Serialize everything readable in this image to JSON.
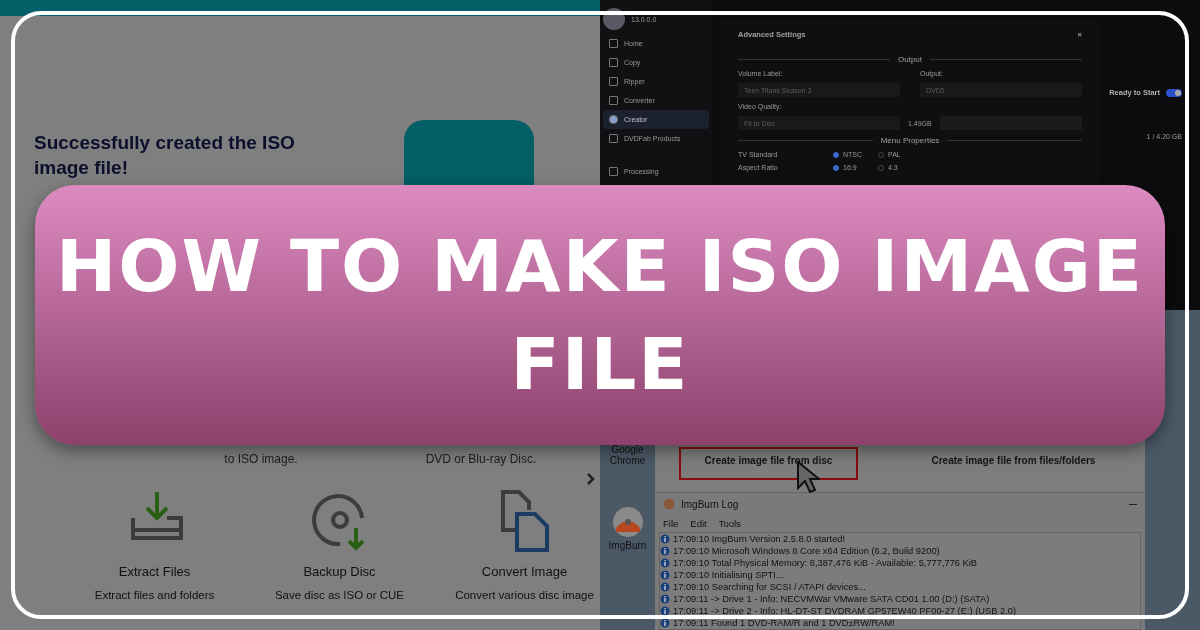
{
  "iso_app": {
    "heading": "Successfully created the ISO image file!",
    "top_tools": [
      {
        "description_tail": "to ISO image."
      },
      {
        "description_tail": "DVD or Blu-ray Disc."
      }
    ],
    "tools": [
      {
        "kind": "extract",
        "title": "Extract Files",
        "description": "Extract files and folders"
      },
      {
        "kind": "backup",
        "title": "Backup Disc",
        "description": "Save disc as ISO or CUE"
      },
      {
        "kind": "convert",
        "title": "Convert Image",
        "description": "Convert various disc image"
      }
    ]
  },
  "dvdfab": {
    "version": "13.0.0.0",
    "nav": [
      {
        "label": "Home",
        "selected": false
      },
      {
        "label": "Copy",
        "selected": false
      },
      {
        "label": "Ripper",
        "selected": false
      },
      {
        "label": "Converter",
        "selected": false
      },
      {
        "label": "Creator",
        "selected": true
      },
      {
        "label": "DVDFab Products",
        "selected": false
      },
      {
        "label": "Processing",
        "selected": false
      }
    ],
    "dialog": {
      "title": "Advanced Settings",
      "close": "×",
      "output_section": "Output",
      "volume_label": "Volume Label:",
      "volume_value": "Teen Titans Season 3",
      "output_label": "Output:",
      "output_value": "DVD5",
      "quality_label": "Video Quality:",
      "quality_value": "Fit to Disc",
      "size": "1.49GB",
      "menu_section": "Menu Properties",
      "options": [
        {
          "label": "TV Standard",
          "choices": [
            {
              "label": "NTSC",
              "selected": true
            },
            {
              "label": "PAL",
              "selected": false
            }
          ]
        },
        {
          "label": "Aspect Ratio",
          "choices": [
            {
              "label": "16:9",
              "selected": true
            },
            {
              "label": "4:3",
              "selected": false
            }
          ]
        }
      ]
    },
    "ready_label": "Ready to Start",
    "ready_on": true,
    "capacity": "1 / 4.20 GB"
  },
  "desktop": {
    "icons": [
      {
        "kind": "chrome",
        "label": "Google Chrome"
      },
      {
        "kind": "imgburn",
        "label": "ImgBurn"
      }
    ],
    "imgburn_options": [
      {
        "label": "Create image file from disc",
        "selected": true
      },
      {
        "label": "Create image file from files/folders",
        "selected": false
      }
    ],
    "log": {
      "title": "ImgBurn Log",
      "menu": [
        "File",
        "Edit",
        "Tools"
      ],
      "lines": [
        "17:09:10 ImgBurn Version 2.5.8.0 started!",
        "17:09:10 Microsoft Windows 8 Core x64 Edition (6.2, Build 9200)",
        "17:09:10 Total Physical Memory: 8,387,476 KiB  -  Available: 5,777,776 KiB",
        "17:09:10 Initialising SPTI...",
        "17:09:10 Searching for SCSI / ATAPI devices...",
        "17:09:11 -> Drive 1 - Info: NECVMWar VMware SATA CD01 1.00 (D:) (SATA)",
        "17:09:11 -> Drive 2 - Info: HL-DT-ST DVDRAM GP57EW40 PF00-27 (E:) (USB 2.0)",
        "17:09:11 Found 1 DVD-RAM/R and 1 DVD±RW/RAM!"
      ]
    }
  },
  "banner": {
    "title": "HOW TO MAKE ISO IMAGE FILE"
  }
}
